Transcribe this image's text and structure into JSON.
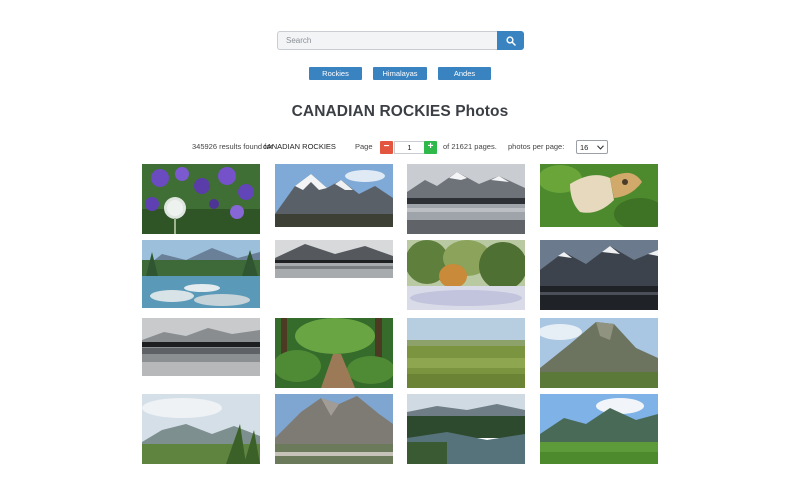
{
  "search": {
    "placeholder": "Search"
  },
  "tags": [
    "Rockies",
    "Himalayas",
    "Andes"
  ],
  "title": "CANADIAN ROCKIES Photos",
  "results": {
    "count_text": "345926 results found for",
    "query": "cANADIAN ROCKIES",
    "page_label": "Page",
    "page": "1",
    "of_pages": "of 21621 pages.",
    "per_page_label": "photos per page:",
    "per_page": "16"
  },
  "colors": {
    "accent": "#3a83c1",
    "minus": "#e3553f",
    "plus": "#2fb94a"
  },
  "icons": {
    "search": "search-icon",
    "minus": "minus-icon",
    "plus": "plus-icon",
    "dropdown": "chevron-down-icon"
  },
  "photos": [
    "purple lupine flowers",
    "snowy mountain range",
    "mountain lake reflection",
    "butterfly on leaf",
    "river with rocks",
    "black and white lake",
    "misty forest trees",
    "dark mountain valley",
    "misty lake reflection",
    "forest trail",
    "green meadow",
    "rocky peak",
    "valley with clouds",
    "mountain with road",
    "river and forest",
    "green hills with mountains"
  ]
}
